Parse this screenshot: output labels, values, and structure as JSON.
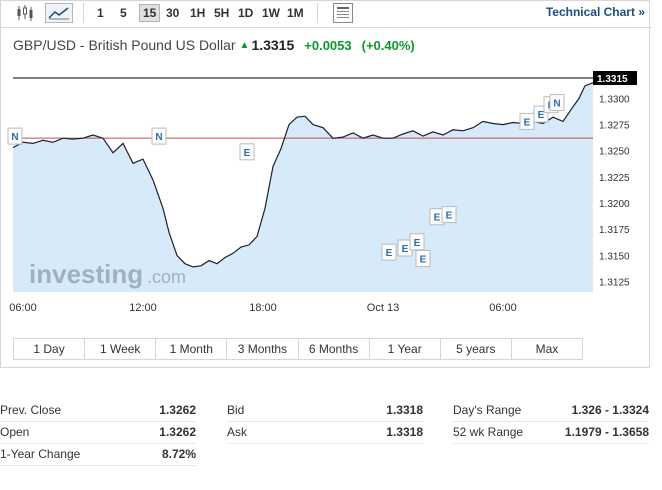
{
  "toolbar": {
    "timeframes": [
      "1",
      "5",
      "15",
      "30",
      "1H",
      "5H",
      "1D",
      "1W",
      "1M"
    ],
    "active_timeframe": "15",
    "technical_chart_label": "Technical Chart",
    "technical_chart_arrow": "»"
  },
  "instrument": {
    "name": "GBP/USD - British Pound US Dollar",
    "price": "1.3315",
    "change": "+0.0053",
    "change_pct": "(+0.40%)"
  },
  "colors": {
    "up": "#0a9a2a",
    "line": "#1f1f2e",
    "area": "#d6eafa",
    "prev_close_line": "#c0504d",
    "link": "#1a4d80"
  },
  "chart_data": {
    "type": "area",
    "x_tick_labels": [
      "06:00",
      "12:00",
      "18:00",
      "Oct 13",
      "06:00"
    ],
    "y_tick_labels": [
      "1.3300",
      "1.3275",
      "1.3250",
      "1.3225",
      "1.3200",
      "1.3175",
      "1.3150",
      "1.3125"
    ],
    "y_ticks": [
      1.33,
      1.3275,
      1.325,
      1.3225,
      1.32,
      1.3175,
      1.315,
      1.3125
    ],
    "ylim": [
      1.3115,
      1.333
    ],
    "x_ticks_at": [
      0.5,
      6.5,
      12.5,
      18.5,
      24.5
    ],
    "xlim": [
      0,
      29
    ],
    "last_price_label": "1.3315",
    "last_price": 1.3315,
    "prev_close": 1.3262,
    "watermark": "investing",
    "watermark_suffix": ".com",
    "x": [
      0,
      0.5,
      1,
      1.5,
      2,
      2.5,
      3,
      3.5,
      4,
      4.5,
      5,
      5.5,
      6,
      6.5,
      7,
      7.5,
      7.8,
      8.2,
      8.6,
      9,
      9.4,
      9.8,
      10.2,
      10.6,
      11,
      11.4,
      11.8,
      12.2,
      12.6,
      13,
      13.4,
      13.8,
      14.2,
      14.6,
      15,
      15.5,
      16,
      16.5,
      17,
      17.5,
      18,
      18.5,
      19,
      19.5,
      20,
      20.5,
      21,
      21.5,
      22,
      22.5,
      23,
      23.5,
      24,
      24.5,
      25,
      25.5,
      26,
      26.5,
      27,
      27.5,
      28,
      28.3,
      28.6,
      29
    ],
    "y": [
      1.3253,
      1.3258,
      1.3257,
      1.326,
      1.3258,
      1.3262,
      1.3261,
      1.3262,
      1.3265,
      1.3262,
      1.3248,
      1.3257,
      1.3238,
      1.3242,
      1.3222,
      1.3195,
      1.3172,
      1.315,
      1.3142,
      1.3139,
      1.314,
      1.3145,
      1.3142,
      1.3148,
      1.3152,
      1.3158,
      1.316,
      1.3168,
      1.3195,
      1.3235,
      1.3252,
      1.3275,
      1.3282,
      1.3283,
      1.3275,
      1.3272,
      1.3262,
      1.3263,
      1.3267,
      1.3262,
      1.3265,
      1.3262,
      1.3262,
      1.3266,
      1.3269,
      1.3264,
      1.3268,
      1.3265,
      1.327,
      1.3269,
      1.3272,
      1.3278,
      1.3276,
      1.3275,
      1.3277,
      1.3276,
      1.3278,
      1.3276,
      1.3282,
      1.3278,
      1.3292,
      1.33,
      1.3312,
      1.3315
    ],
    "event_markers": [
      {
        "label": "N",
        "x": 0.1,
        "y": 1.3264
      },
      {
        "label": "N",
        "x": 7.3,
        "y": 1.3264
      },
      {
        "label": "E",
        "x": 11.7,
        "y": 1.3249
      },
      {
        "label": "E",
        "x": 18.8,
        "y": 1.3153
      },
      {
        "label": "E",
        "x": 19.6,
        "y": 1.3157
      },
      {
        "label": "E",
        "x": 20.5,
        "y": 1.3147
      },
      {
        "label": "E",
        "x": 20.2,
        "y": 1.3163
      },
      {
        "label": "E",
        "x": 21.2,
        "y": 1.3187
      },
      {
        "label": "E",
        "x": 21.8,
        "y": 1.3189
      },
      {
        "label": "E",
        "x": 25.7,
        "y": 1.3278
      },
      {
        "label": "E",
        "x": 26.4,
        "y": 1.3285
      },
      {
        "label": "E",
        "x": 26.9,
        "y": 1.3294
      },
      {
        "label": "N",
        "x": 27.2,
        "y": 1.3296
      }
    ]
  },
  "ranges": [
    "1 Day",
    "1 Week",
    "1 Month",
    "3 Months",
    "6 Months",
    "1 Year",
    "5 years",
    "Max"
  ],
  "stats": {
    "col1": [
      {
        "label": "Prev. Close",
        "value": "1.3262"
      },
      {
        "label": "Open",
        "value": "1.3262"
      },
      {
        "label": "1-Year Change",
        "value": "8.72%"
      }
    ],
    "col2": [
      {
        "label": "Bid",
        "value": "1.3318"
      },
      {
        "label": "Ask",
        "value": "1.3318"
      }
    ],
    "col3": [
      {
        "label": "Day's Range",
        "value": "1.326 - 1.3324"
      },
      {
        "label": "52 wk Range",
        "value": "1.1979 - 1.3658"
      }
    ]
  }
}
